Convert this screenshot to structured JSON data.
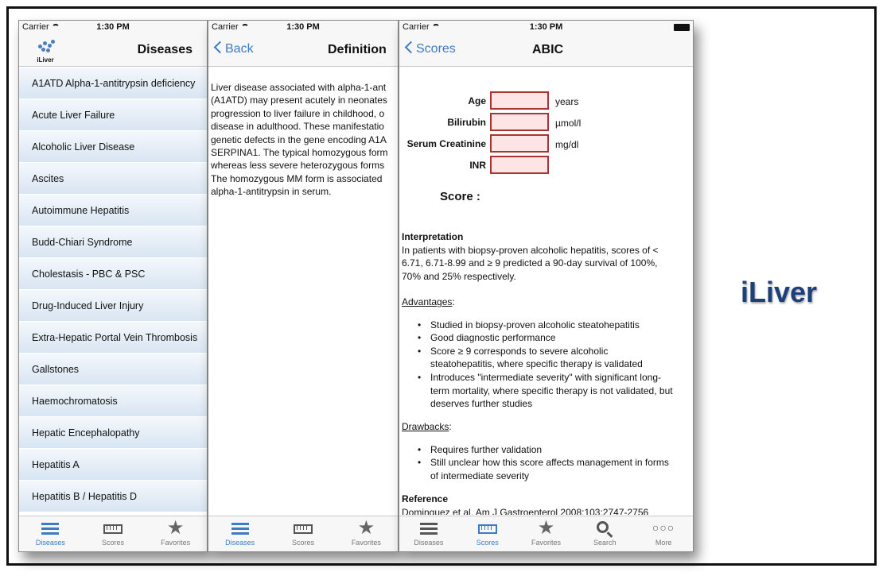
{
  "status": {
    "carrier": "Carrier",
    "time": "1:30 PM"
  },
  "screen1": {
    "title": "Diseases",
    "logo_text": "iLiver",
    "items": [
      "A1ATD Alpha-1-antitrypsin deficiency",
      "Acute Liver Failure",
      "Alcoholic Liver Disease",
      "Ascites",
      "Autoimmune Hepatitis",
      "Budd-Chiari Syndrome",
      "Cholestasis - PBC & PSC",
      "Drug-Induced Liver Injury",
      "Extra-Hepatic Portal Vein Thrombosis",
      "Gallstones",
      "Haemochromatosis",
      "Hepatic Encephalopathy",
      "Hepatitis A",
      "Hepatitis B / Hepatitis D"
    ],
    "tabs": [
      "Diseases",
      "Scores",
      "Favorites"
    ]
  },
  "screen2": {
    "back": "Back",
    "title": "Definition",
    "lines": [
      "Liver disease associated with alpha-1-ant",
      "(A1ATD) may present acutely in neonates",
      "progression to liver failure in childhood, o",
      "disease in adulthood. These manifestatio",
      "genetic defects in the gene encoding A1A",
      "SERPINA1. The typical homozygous form",
      "whereas less severe heterozygous forms",
      "The homozygous MM form is associated",
      "alpha-1-antitrypsin in serum."
    ],
    "tabs": [
      "Diseases",
      "Scores",
      "Favorites"
    ]
  },
  "screen3": {
    "back": "Scores",
    "title": "ABIC",
    "fields": [
      {
        "label": "Age",
        "unit": "years"
      },
      {
        "label": "Bilirubin",
        "unit": "µmol/l"
      },
      {
        "label": "Serum Creatinine",
        "unit": "mg/dl"
      },
      {
        "label": "INR",
        "unit": ""
      }
    ],
    "score_label": "Score :",
    "interpretation_heading": "Interpretation",
    "interpretation_lines": [
      "In patients with biopsy-proven alcoholic hepatitis, scores of <",
      "6.71, 6.71-8.99 and ≥ 9 predicted a 90-day survival of 100%,",
      "70% and 25% respectively."
    ],
    "advantages_heading": "Advantages",
    "advantages": [
      [
        "Studied in biopsy-proven alcoholic steatohepatitis"
      ],
      [
        "Good diagnostic performance"
      ],
      [
        "Score ≥ 9 corresponds to severe alcoholic",
        "steatohepatitis, where specific therapy is validated"
      ],
      [
        "Introduces \"intermediate severity\" with significant long-",
        "term mortality, where specific therapy is not validated, but",
        "deserves further studies"
      ]
    ],
    "drawbacks_heading": "Drawbacks",
    "drawbacks": [
      [
        "Requires further validation"
      ],
      [
        "Still unclear how this score affects management in forms",
        "of intermediate severity"
      ]
    ],
    "reference_heading": "Reference",
    "reference": "Dominguez et al. Am J Gastroenterol 2008;103:2747-2756",
    "tabs": [
      "Diseases",
      "Scores",
      "Favorites",
      "Search",
      "More"
    ]
  },
  "brand": "iLiver",
  "colors": {
    "accent": "#3d7bc4",
    "brand": "#1d3f7a",
    "input_fill": "#fde5e5",
    "input_border": "#aa3333"
  }
}
